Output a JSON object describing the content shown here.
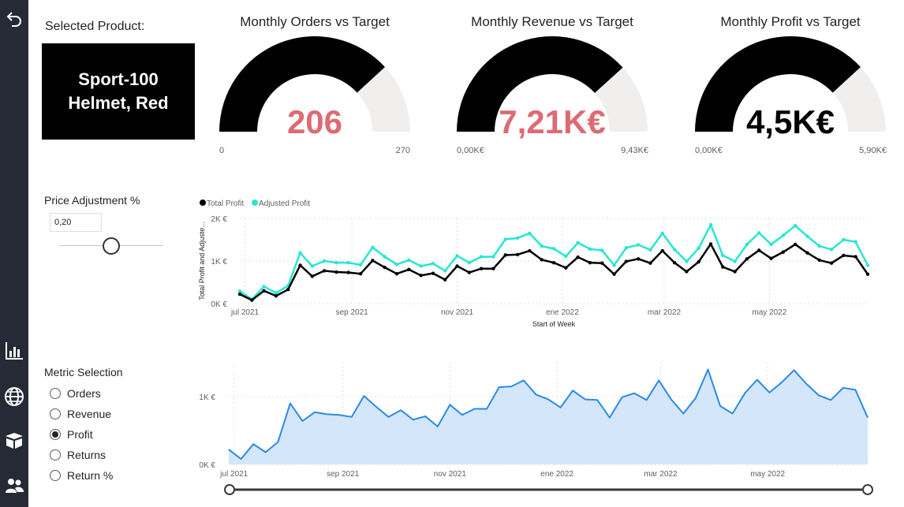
{
  "nav": {
    "items": [
      {
        "icon": "back-arrow-icon"
      },
      {
        "icon": "bar-chart-icon"
      },
      {
        "icon": "globe-icon"
      },
      {
        "icon": "box-icon"
      },
      {
        "icon": "users-icon"
      }
    ]
  },
  "selected_product": {
    "label": "Selected Product:",
    "value": "Sport-100 Helmet, Red"
  },
  "gauges": [
    {
      "title": "Monthly Orders vs Target",
      "value_text": "206",
      "min": "0",
      "max": "270",
      "fraction": 0.763,
      "value_color": "#dd6b73"
    },
    {
      "title": "Monthly Revenue vs Target",
      "value_text": "7,21K€",
      "min": "0,00K€",
      "max": "9,43K€",
      "fraction": 0.765,
      "value_color": "#dd6b73"
    },
    {
      "title": "Monthly Profit vs Target",
      "value_text": "4,5K€",
      "min": "0,00K€",
      "max": "5,90K€",
      "fraction": 0.763,
      "value_color": "#000000"
    }
  ],
  "price_adjustment": {
    "label": "Price Adjustment %",
    "value": "0,20",
    "slider_fraction": 0.5
  },
  "metric_selection": {
    "label": "Metric Selection",
    "options": [
      {
        "label": "Orders",
        "selected": false
      },
      {
        "label": "Revenue",
        "selected": false
      },
      {
        "label": "Profit",
        "selected": true
      },
      {
        "label": "Returns",
        "selected": false
      },
      {
        "label": "Return %",
        "selected": false
      }
    ]
  },
  "colors": {
    "rail": "#252a36",
    "total_profit": "#000000",
    "adjusted_profit": "#29e6d1",
    "area_line": "#2b8ae6",
    "area_fill": "#d3e6fa",
    "gauge_fill": "#000000",
    "gauge_track": "#f0efee"
  },
  "chart_data": [
    {
      "type": "line",
      "legend": [
        "Total Profit",
        "Adjusted Profit"
      ],
      "legend_position": "top-left",
      "xlabel": "Start of Week",
      "ylabel": "Total Profit and Adjuste...",
      "x_ticks": [
        "jul 2021",
        "sep 2021",
        "nov 2021",
        "ene 2022",
        "mar 2022",
        "may 2022"
      ],
      "y_ticks": [
        "0K €",
        "1K €",
        "2K €"
      ],
      "ylim": [
        0,
        2000
      ],
      "grid": true,
      "x": [
        "2021-06-28",
        "2021-07-05",
        "2021-07-12",
        "2021-07-19",
        "2021-07-26",
        "2021-08-02",
        "2021-08-09",
        "2021-08-16",
        "2021-08-23",
        "2021-08-30",
        "2021-09-06",
        "2021-09-13",
        "2021-09-20",
        "2021-09-27",
        "2021-10-04",
        "2021-10-11",
        "2021-10-18",
        "2021-10-25",
        "2021-11-01",
        "2021-11-08",
        "2021-11-15",
        "2021-11-22",
        "2021-11-29",
        "2021-12-06",
        "2021-12-13",
        "2021-12-20",
        "2021-12-27",
        "2022-01-03",
        "2022-01-10",
        "2022-01-17",
        "2022-01-24",
        "2022-01-31",
        "2022-02-07",
        "2022-02-14",
        "2022-02-21",
        "2022-02-28",
        "2022-03-07",
        "2022-03-14",
        "2022-03-21",
        "2022-03-28",
        "2022-04-04",
        "2022-04-11",
        "2022-04-18",
        "2022-04-25",
        "2022-05-02",
        "2022-05-09",
        "2022-05-16",
        "2022-05-23",
        "2022-05-30",
        "2022-06-06",
        "2022-06-13",
        "2022-06-20",
        "2022-06-27"
      ],
      "series": [
        {
          "name": "Total Profit",
          "values": [
            220,
            80,
            300,
            180,
            330,
            900,
            640,
            770,
            740,
            730,
            700,
            1010,
            850,
            700,
            800,
            660,
            710,
            560,
            880,
            730,
            820,
            820,
            1140,
            1150,
            1240,
            1030,
            960,
            840,
            1090,
            960,
            950,
            690,
            990,
            1050,
            950,
            1240,
            960,
            750,
            980,
            1400,
            860,
            750,
            1050,
            1250,
            1060,
            1210,
            1390,
            1190,
            1020,
            950,
            1130,
            1100,
            690
          ]
        },
        {
          "name": "Adjusted Profit",
          "values": [
            290,
            100,
            400,
            250,
            420,
            1190,
            880,
            1000,
            960,
            960,
            910,
            1320,
            1100,
            920,
            1020,
            880,
            940,
            770,
            1120,
            960,
            1100,
            1100,
            1510,
            1540,
            1650,
            1350,
            1290,
            1110,
            1430,
            1280,
            1250,
            900,
            1310,
            1380,
            1260,
            1650,
            1270,
            990,
            1300,
            1850,
            1130,
            990,
            1390,
            1660,
            1390,
            1600,
            1830,
            1580,
            1350,
            1270,
            1500,
            1450,
            900
          ]
        }
      ]
    },
    {
      "type": "area",
      "x_ticks": [
        "jul 2021",
        "sep 2021",
        "nov 2021",
        "ene 2022",
        "mar 2022",
        "may 2022"
      ],
      "y_ticks": [
        "0K €",
        "1K €"
      ],
      "ylim": [
        0,
        1500
      ],
      "grid": true,
      "x": [
        "2021-06-28",
        "2021-07-05",
        "2021-07-12",
        "2021-07-19",
        "2021-07-26",
        "2021-08-02",
        "2021-08-09",
        "2021-08-16",
        "2021-08-23",
        "2021-08-30",
        "2021-09-06",
        "2021-09-13",
        "2021-09-20",
        "2021-09-27",
        "2021-10-04",
        "2021-10-11",
        "2021-10-18",
        "2021-10-25",
        "2021-11-01",
        "2021-11-08",
        "2021-11-15",
        "2021-11-22",
        "2021-11-29",
        "2021-12-06",
        "2021-12-13",
        "2021-12-20",
        "2021-12-27",
        "2022-01-03",
        "2022-01-10",
        "2022-01-17",
        "2022-01-24",
        "2022-01-31",
        "2022-02-07",
        "2022-02-14",
        "2022-02-21",
        "2022-02-28",
        "2022-03-07",
        "2022-03-14",
        "2022-03-21",
        "2022-03-28",
        "2022-04-04",
        "2022-04-11",
        "2022-04-18",
        "2022-04-25",
        "2022-05-02",
        "2022-05-09",
        "2022-05-16",
        "2022-05-23",
        "2022-05-30",
        "2022-06-06",
        "2022-06-13",
        "2022-06-20",
        "2022-06-27"
      ],
      "values": [
        220,
        80,
        300,
        180,
        330,
        900,
        640,
        770,
        740,
        730,
        700,
        1010,
        850,
        700,
        800,
        660,
        710,
        560,
        880,
        730,
        820,
        820,
        1140,
        1150,
        1240,
        1030,
        960,
        840,
        1090,
        960,
        950,
        690,
        990,
        1050,
        950,
        1240,
        960,
        750,
        980,
        1400,
        860,
        750,
        1050,
        1250,
        1060,
        1210,
        1390,
        1190,
        1020,
        950,
        1130,
        1100,
        690
      ]
    }
  ],
  "range_slider": {
    "start_fraction": 0.0,
    "end_fraction": 1.0
  }
}
